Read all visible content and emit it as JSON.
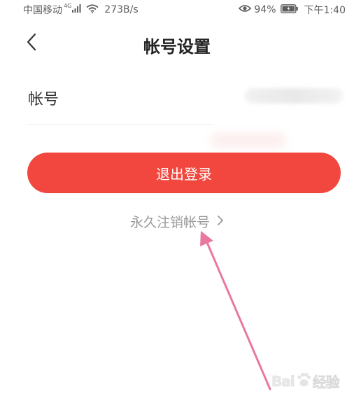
{
  "status_bar": {
    "carrier": "中国移动",
    "network_type": "4G",
    "speed": "273B/s",
    "battery_percent": "94%",
    "time": "下午1:40",
    "icons": [
      "signal-icon",
      "wifi-icon",
      "eye-icon",
      "battery-icon"
    ]
  },
  "header": {
    "title": "帐号设置",
    "back_icon": "chevron-left-icon"
  },
  "account": {
    "label": "帐号"
  },
  "actions": {
    "logout_label": "退出登录",
    "cancel_account_label": "永久注销帐号",
    "cancel_account_icon": "chevron-right-icon"
  },
  "watermark": {
    "text_left": "Bai",
    "text_right": "经验"
  },
  "colors": {
    "accent_red": "#f2473f",
    "annotation_arrow": "#e8799d",
    "muted_text": "#9a9a9a"
  }
}
